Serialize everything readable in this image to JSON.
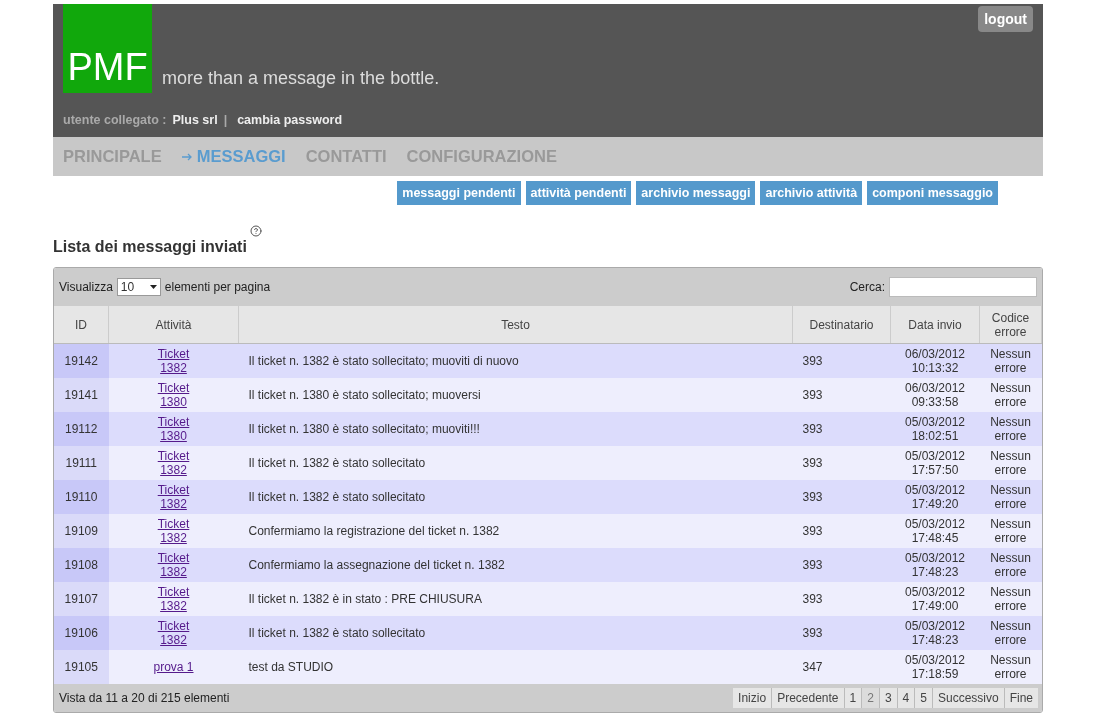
{
  "header": {
    "logo": "PMF",
    "tagline": "more than a message in the bottle.",
    "logout": "logout",
    "user_label": "utente collegato :",
    "user_name": "Plus srl",
    "separator": "|",
    "change_password": "cambia password"
  },
  "nav": [
    {
      "label": "PRINCIPALE",
      "selected": false
    },
    {
      "label": "MESSAGGI",
      "selected": true
    },
    {
      "label": "CONTATTI",
      "selected": false
    },
    {
      "label": "CONFIGURAZIONE",
      "selected": false
    }
  ],
  "subnav": [
    "messaggi pendenti",
    "attività pendenti",
    "archivio messaggi",
    "archivio attività",
    "componi messaggio"
  ],
  "title": "Lista dei messaggi inviati",
  "table": {
    "show_label": "Visualizza",
    "page_size": "10",
    "per_page_label": "elementi per pagina",
    "search_label": "Cerca:",
    "columns": [
      "ID",
      "Attività",
      "Testo",
      "Destinatario",
      "Data invio",
      "Codice errore"
    ],
    "rows": [
      {
        "id": "19142",
        "activity": "Ticket 1382",
        "text": "Il ticket n. 1382 è stato sollecitato; muoviti di nuovo",
        "recipient": "393",
        "date": "06/03/2012",
        "time": "10:13:32",
        "error": "Nessun errore"
      },
      {
        "id": "19141",
        "activity": "Ticket 1380",
        "text": "Il ticket n. 1380 è stato sollecitato; muoversi",
        "recipient": "393",
        "date": "06/03/2012",
        "time": "09:33:58",
        "error": "Nessun errore"
      },
      {
        "id": "19112",
        "activity": "Ticket 1380",
        "text": "Il ticket n. 1380 è stato sollecitato; muoviti!!!",
        "recipient": "393",
        "date": "05/03/2012",
        "time": "18:02:51",
        "error": "Nessun errore"
      },
      {
        "id": "19111",
        "activity": "Ticket 1382",
        "text": "Il ticket n. 1382 è stato sollecitato",
        "recipient": "393",
        "date": "05/03/2012",
        "time": "17:57:50",
        "error": "Nessun errore"
      },
      {
        "id": "19110",
        "activity": "Ticket 1382",
        "text": "Il ticket n. 1382 è stato sollecitato",
        "recipient": "393",
        "date": "05/03/2012",
        "time": "17:49:20",
        "error": "Nessun errore"
      },
      {
        "id": "19109",
        "activity": "Ticket 1382",
        "text": "Confermiamo la registrazione del ticket n. 1382",
        "recipient": "393",
        "date": "05/03/2012",
        "time": "17:48:45",
        "error": "Nessun errore"
      },
      {
        "id": "19108",
        "activity": "Ticket 1382",
        "text": "Confermiamo la assegnazione del ticket n. 1382",
        "recipient": "393",
        "date": "05/03/2012",
        "time": "17:48:23",
        "error": "Nessun errore"
      },
      {
        "id": "19107",
        "activity": "Ticket 1382",
        "text": "Il ticket n. 1382 è in stato : PRE CHIUSURA",
        "recipient": "393",
        "date": "05/03/2012",
        "time": "17:49:00",
        "error": "Nessun errore"
      },
      {
        "id": "19106",
        "activity": "Ticket 1382",
        "text": "Il ticket n. 1382 è stato sollecitato",
        "recipient": "393",
        "date": "05/03/2012",
        "time": "17:48:23",
        "error": "Nessun errore"
      },
      {
        "id": "19105",
        "activity": "prova 1",
        "text": "test da STUDIO",
        "recipient": "347",
        "date": "05/03/2012",
        "time": "17:18:59",
        "error": "Nessun errore"
      }
    ],
    "info": "Vista da 11 a 20 di 215 elementi",
    "pager": {
      "first": "Inizio",
      "previous": "Precedente",
      "pages": [
        {
          "label": "1",
          "selected": false
        },
        {
          "label": "2",
          "selected": true
        },
        {
          "label": "3",
          "selected": false
        },
        {
          "label": "4",
          "selected": false
        },
        {
          "label": "5",
          "selected": false
        }
      ],
      "next": "Successivo",
      "last": "Fine"
    }
  }
}
